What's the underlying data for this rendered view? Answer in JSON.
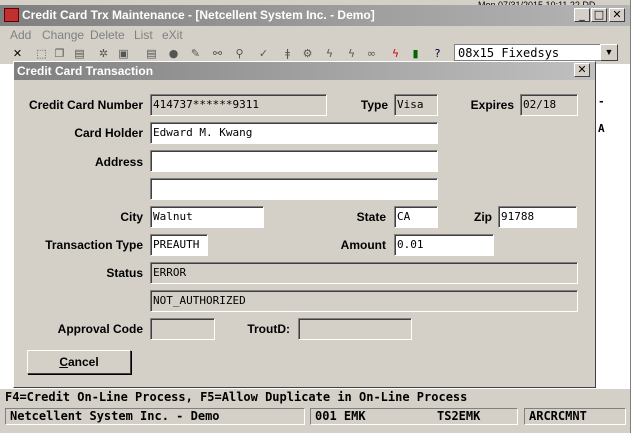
{
  "window": {
    "title": "Credit Card Trx Maintenance - [Netcellent System Inc. - Demo]",
    "top_clock": "Mon 07/31/2015 10:11       22 DD"
  },
  "menu": [
    "Add",
    "Change",
    "Delete",
    "List",
    "eXit"
  ],
  "toolbar": {
    "font_select": "08x15 Fixedsys"
  },
  "background_text": {
    "right1": "-",
    "right2": "A"
  },
  "dialog": {
    "title": "Credit Card Transaction",
    "labels": {
      "card_number": "Credit Card Number",
      "type": "Type",
      "expires": "Expires",
      "card_holder": "Card Holder",
      "address": "Address",
      "city": "City",
      "state": "State",
      "zip": "Zip",
      "trx_type": "Transaction Type",
      "amount": "Amount",
      "status": "Status",
      "approval_code": "Approval Code",
      "trout_id": "TroutD:"
    },
    "values": {
      "card_number": "414737******9311",
      "type": "Visa",
      "expires": "02/18",
      "card_holder": "Edward M. Kwang",
      "address1": "",
      "address2": "",
      "city": "Walnut",
      "state": "CA",
      "zip": "91788",
      "trx_type": "PREAUTH",
      "amount": "0.01",
      "status1": "ERROR",
      "status2": "NOT_AUTHORIZED",
      "approval_code": "",
      "trout_id": ""
    },
    "cancel_label": "ancel",
    "cancel_mnemonic": "C"
  },
  "hint": "F4=Credit On-Line Process, F5=Allow Duplicate in On-Line Process",
  "status": {
    "company": "Netcellent System Inc. - Demo",
    "user": "001 EMK",
    "terminal": "TS2EMK",
    "program": "ARCRCMNT"
  }
}
